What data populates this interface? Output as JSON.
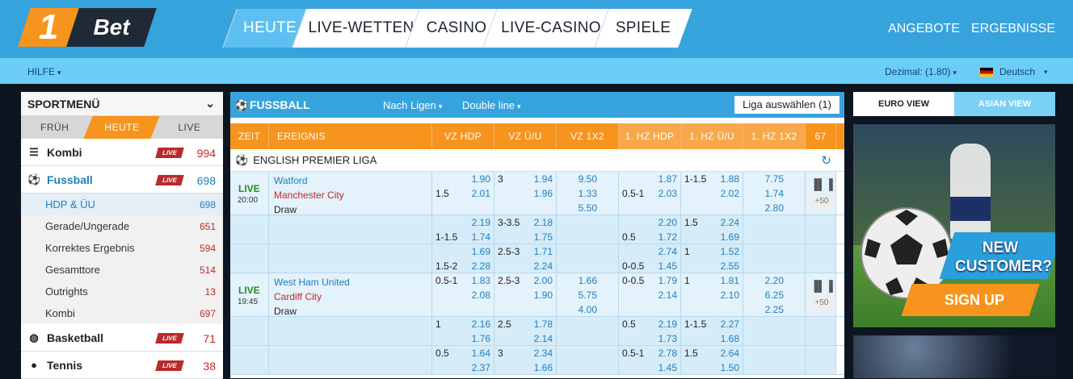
{
  "logo": {
    "one": "1",
    "bet": "Bet"
  },
  "nav": [
    "HEUTE",
    "LIVE-WETTEN",
    "CASINO",
    "LIVE-CASINO",
    "SPIELE"
  ],
  "topright": [
    "ANGEBOTE",
    "ERGEBNISSE"
  ],
  "subbar": {
    "hilfe": "HILFE",
    "dezimal": "Dezimal: (1.80)",
    "sprache": "Deutsch"
  },
  "leftmenu": {
    "title": "SPORTMENÜ",
    "tabs": [
      "FRÜH",
      "HEUTE",
      "LIVE"
    ],
    "live_badge": "LIVE",
    "sports": [
      {
        "name": "Kombi",
        "count": "994"
      },
      {
        "name": "Fussball",
        "count": "698"
      },
      {
        "name": "Basketball",
        "count": "71"
      },
      {
        "name": "Tennis",
        "count": "38"
      }
    ],
    "subs": [
      {
        "name": "HDP & ÜU",
        "count": "698"
      },
      {
        "name": "Gerade/Ungerade",
        "count": "651"
      },
      {
        "name": "Korrektes Ergebnis",
        "count": "594"
      },
      {
        "name": "Gesamttore",
        "count": "514"
      },
      {
        "name": "Outrights",
        "count": "13"
      },
      {
        "name": "Kombi",
        "count": "697"
      }
    ]
  },
  "center": {
    "title": "FUSSBALL",
    "nach_ligen": "Nach Ligen",
    "double_line": "Double line",
    "liga": "Liga auswählen (1)",
    "headers": [
      "ZEIT",
      "EREIGNIS",
      "VZ HDP",
      "VZ Ü/U",
      "VZ 1X2",
      "1. HZ HDP",
      "1. HZ Ü/U",
      "1. HZ 1X2",
      "67"
    ],
    "league": "ENGLISH PREMIER LIGA",
    "live": "LIVE",
    "more": "+50",
    "matches": [
      {
        "time": "20:00",
        "home": "Watford",
        "away": "Manchester City",
        "draw": "Draw",
        "rows": [
          {
            "hdp": [
              "",
              "1.90",
              "1.5",
              "2.01"
            ],
            "ou": [
              "3",
              "1.94",
              "",
              "1.96"
            ],
            "x12": [
              "9.50",
              "1.33",
              "5.50"
            ],
            "hhdp": [
              "",
              "1.87",
              "0.5-1",
              "2.03"
            ],
            "hou": [
              "1-1.5",
              "1.88",
              "",
              "2.02"
            ],
            "h12": [
              "7.75",
              "1.74",
              "2.80"
            ]
          },
          {
            "hdp": [
              "",
              "2.19",
              "1-1.5",
              "1.74"
            ],
            "ou": [
              "3-3.5",
              "2.18",
              "",
              "1.75"
            ],
            "x12": [],
            "hhdp": [
              "",
              "2.20",
              "0.5",
              "1.72"
            ],
            "hou": [
              "1.5",
              "2.24",
              "",
              "1.69"
            ],
            "h12": []
          },
          {
            "hdp": [
              "",
              "1.69",
              "1.5-2",
              "2.28"
            ],
            "ou": [
              "2.5-3",
              "1.71",
              "",
              "2.24"
            ],
            "x12": [],
            "hhdp": [
              "",
              "2.74",
              "0-0.5",
              "1.45"
            ],
            "hou": [
              "1",
              "1.52",
              "",
              "2.55"
            ],
            "h12": []
          }
        ]
      },
      {
        "time": "19:45",
        "home": "West Ham United",
        "away": "Cardiff City",
        "draw": "Draw",
        "rows": [
          {
            "hdp": [
              "0.5-1",
              "1.83",
              "",
              "2.08"
            ],
            "ou": [
              "2.5-3",
              "2.00",
              "",
              "1.90"
            ],
            "x12": [
              "1.66",
              "5.75",
              "4.00"
            ],
            "hhdp": [
              "0-0.5",
              "1.79",
              "",
              "2.14"
            ],
            "hou": [
              "1",
              "1.81",
              "",
              "2.10"
            ],
            "h12": [
              "2.20",
              "6.25",
              "2.25"
            ]
          },
          {
            "hdp": [
              "1",
              "2.16",
              "",
              "1.76"
            ],
            "ou": [
              "2.5",
              "1.78",
              "",
              "2.14"
            ],
            "x12": [],
            "hhdp": [
              "0.5",
              "2.19",
              "",
              "1.73"
            ],
            "hou": [
              "1-1.5",
              "2.27",
              "",
              "1.68"
            ],
            "h12": []
          },
          {
            "hdp": [
              "0.5",
              "1.64",
              "",
              "2.37"
            ],
            "ou": [
              "3",
              "2.34",
              "",
              "1.66"
            ],
            "x12": [],
            "hhdp": [
              "0.5-1",
              "2.78",
              "",
              "1.45"
            ],
            "hou": [
              "1.5",
              "2.64",
              "",
              "1.50"
            ],
            "h12": []
          }
        ]
      }
    ]
  },
  "right": {
    "tabs": [
      "EURO VIEW",
      "ASIAN VIEW"
    ],
    "banner_new": "NEW",
    "banner_customer": "CUSTOMER?",
    "banner_signup": "SIGN UP"
  },
  "colors": {
    "primary_blue": "#37a3dd",
    "light_blue": "#6ccdf7",
    "orange": "#f7941d",
    "live_red": "#b92a2a"
  }
}
